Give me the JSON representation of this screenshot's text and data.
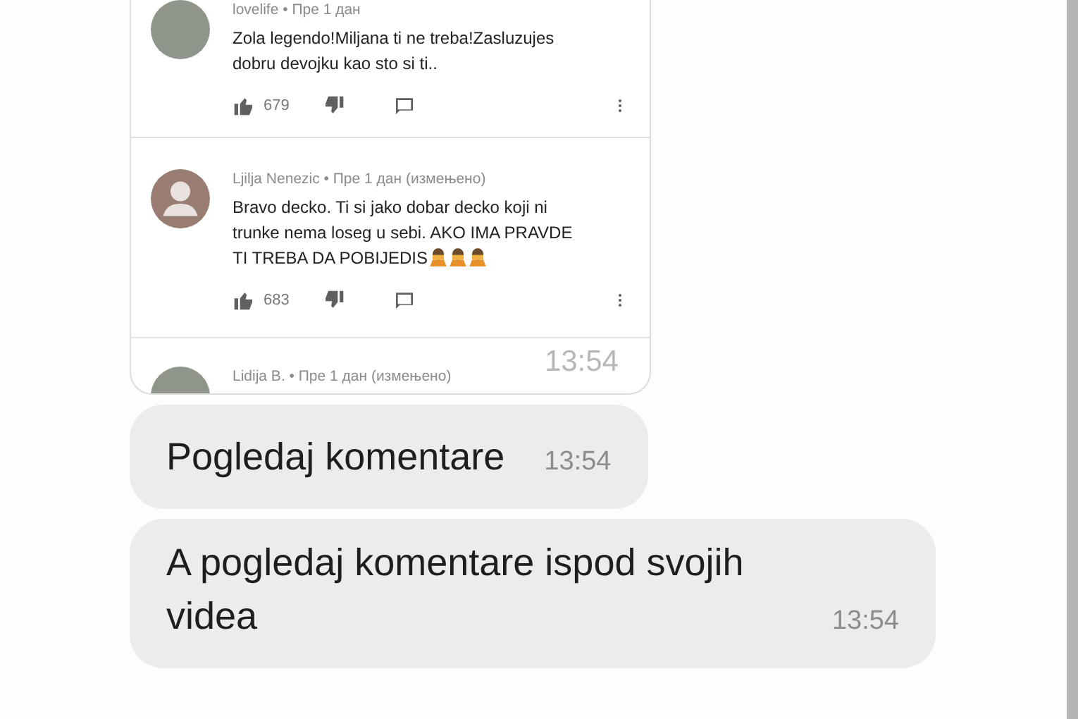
{
  "messages": [
    {
      "kind": "image",
      "time": "13:54",
      "comments": [
        {
          "kind": "photo",
          "byline": "lovelife • Пре 1 дан",
          "text": "Zola legendo!Miljana ti ne treba!Zasluzujes dobru devojku kao sto si ti..",
          "likes": "679",
          "emoji": false
        },
        {
          "kind": "default",
          "byline": "Ljilja Nenezic • Пре 1 дан (измењено)",
          "text": "Bravo decko. Ti si jako dobar decko koji ni trunke nema loseg u sebi. AKO IMA PRAVDE TI TREBA DA POBIJEDIS",
          "likes": "683",
          "emoji": true
        },
        {
          "kind": "photo",
          "byline": "Lidija B. • Пре 1 дан (измењено)"
        }
      ]
    },
    {
      "kind": "text",
      "text": "Pogledaj komentare",
      "time": "13:54"
    },
    {
      "kind": "text",
      "text": "A pogledaj komentare ispod svojih videa",
      "time": "13:54"
    }
  ]
}
